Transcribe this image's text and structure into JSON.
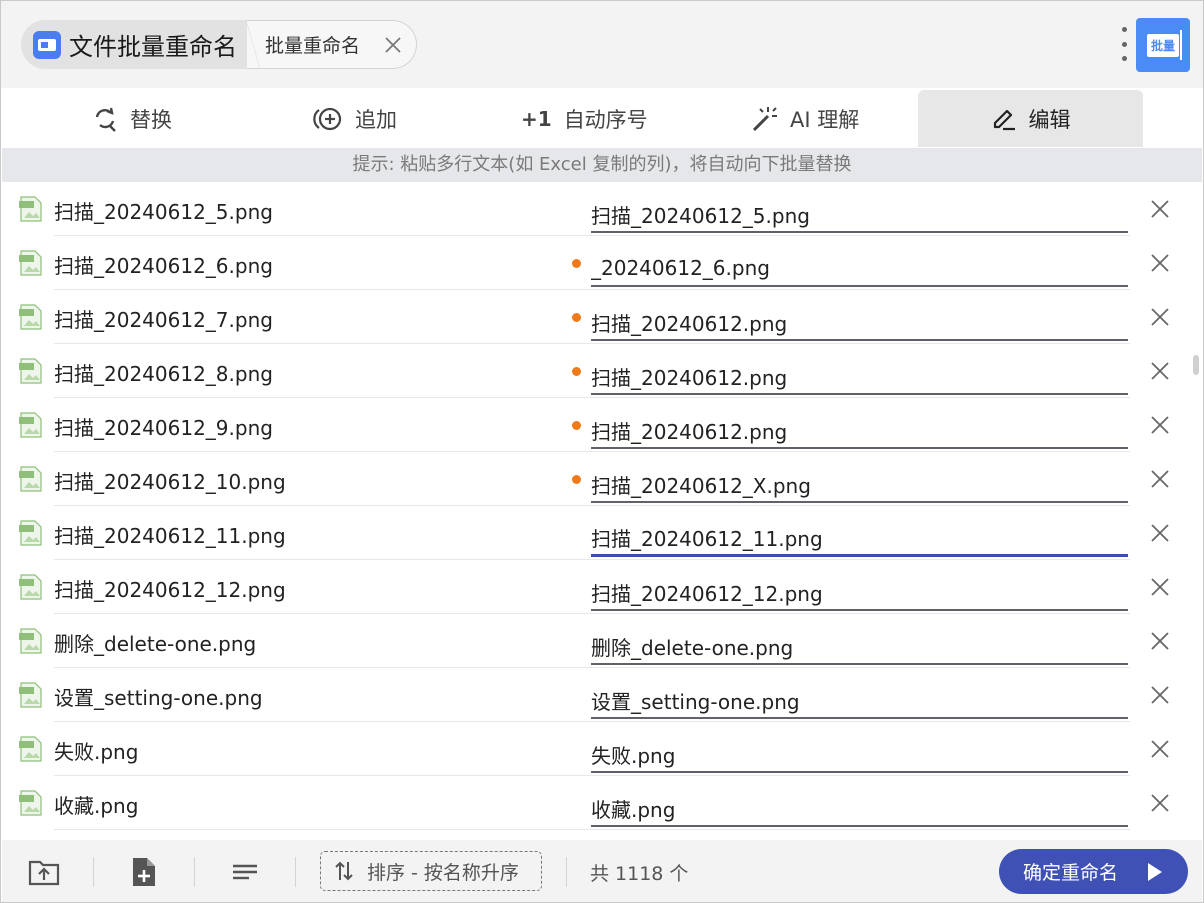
{
  "app": {
    "title": "文件批量重命名",
    "sub_tab": "批量重命名",
    "corner_badge": "批量"
  },
  "tabs": [
    {
      "label": "替换",
      "icon": "replace-icon"
    },
    {
      "label": "追加",
      "icon": "add-circle-icon"
    },
    {
      "label": "自动序号",
      "icon": "plus-one-icon",
      "icon_text": "+1"
    },
    {
      "label": "AI 理解",
      "icon": "magic-wand-icon"
    },
    {
      "label": "编辑",
      "icon": "pen-icon",
      "active": true
    }
  ],
  "hint": "提示: 粘贴多行文本(如 Excel 复制的列)，将自动向下批量替换",
  "rows": [
    {
      "original": "扫描_20240612_5.png",
      "new_name": "扫描_20240612_5.png",
      "modified": false
    },
    {
      "original": "扫描_20240612_6.png",
      "new_name": "_20240612_6.png",
      "modified": true
    },
    {
      "original": "扫描_20240612_7.png",
      "new_name": "扫描_20240612.png",
      "modified": true
    },
    {
      "original": "扫描_20240612_8.png",
      "new_name": "扫描_20240612.png",
      "modified": true
    },
    {
      "original": "扫描_20240612_9.png",
      "new_name": "扫描_20240612.png",
      "modified": true
    },
    {
      "original": "扫描_20240612_10.png",
      "new_name": "扫描_20240612_X.png",
      "modified": true
    },
    {
      "original": "扫描_20240612_11.png",
      "new_name": "扫描_20240612_11.png",
      "modified": false,
      "focused": true
    },
    {
      "original": "扫描_20240612_12.png",
      "new_name": "扫描_20240612_12.png",
      "modified": false
    },
    {
      "original": "删除_delete-one.png",
      "new_name": "删除_delete-one.png",
      "modified": false
    },
    {
      "original": "设置_setting-one.png",
      "new_name": "设置_setting-one.png",
      "modified": false
    },
    {
      "original": "失败.png",
      "new_name": "失败.png",
      "modified": false
    },
    {
      "original": "收藏.png",
      "new_name": "收藏.png",
      "modified": false
    }
  ],
  "footer": {
    "sort_label": "排序 - 按名称升序",
    "count_label": "共 1118 个",
    "confirm_label": "确定重命名"
  },
  "colors": {
    "accent": "#3f51b5",
    "modified_dot": "#f07a18",
    "corner_icon": "#4a8bf5"
  }
}
